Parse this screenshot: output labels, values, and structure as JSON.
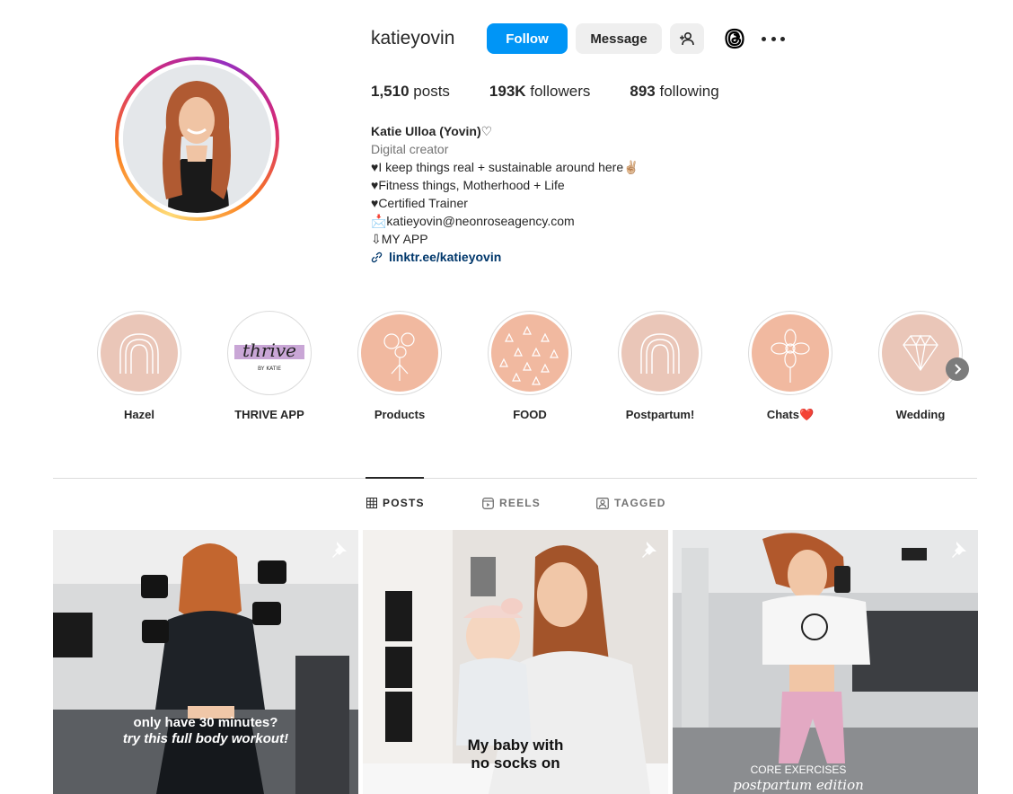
{
  "profile": {
    "username": "katieyovin",
    "follow_label": "Follow",
    "message_label": "Message",
    "stats": {
      "posts_count": "1,510",
      "posts_label": "posts",
      "followers_count": "193K",
      "followers_label": "followers",
      "following_count": "893",
      "following_label": "following"
    },
    "bio": {
      "name": "Katie Ulloa (Yovin)♡",
      "category": "Digital creator",
      "line1": "♥I keep things real + sustainable around here✌🏼",
      "line2": "♥Fitness things, Motherhood + Life",
      "line3": "♥Certified Trainer",
      "line4": "📩katieyovin@neonroseagency.com",
      "line5": "⇩MY APP",
      "link": "linktr.ee/katieyovin"
    }
  },
  "highlights": [
    {
      "label": "Hazel"
    },
    {
      "label": "THRIVE APP"
    },
    {
      "label": "Products"
    },
    {
      "label": "FOOD"
    },
    {
      "label": "Postpartum!"
    },
    {
      "label": "Chats❤️"
    },
    {
      "label": "Wedding"
    }
  ],
  "highlight_art": {
    "thrive_script": "thrive",
    "thrive_sub": "BY KATIE"
  },
  "tabs": [
    {
      "label": "POSTS"
    },
    {
      "label": "REELS"
    },
    {
      "label": "TAGGED"
    }
  ],
  "posts": [
    {
      "caption_line1": "only have 30 minutes?",
      "caption_line2": "try this full body workout!"
    },
    {
      "caption_line1": "My baby with",
      "caption_line2": "no socks on"
    },
    {
      "caption_line1": "CORE EXERCISES",
      "caption_line2": "postpartum edition"
    }
  ],
  "colors": {
    "follow_blue": "#0095f6",
    "link_blue": "#00376b",
    "highlight_peach": "#eac6b8"
  }
}
